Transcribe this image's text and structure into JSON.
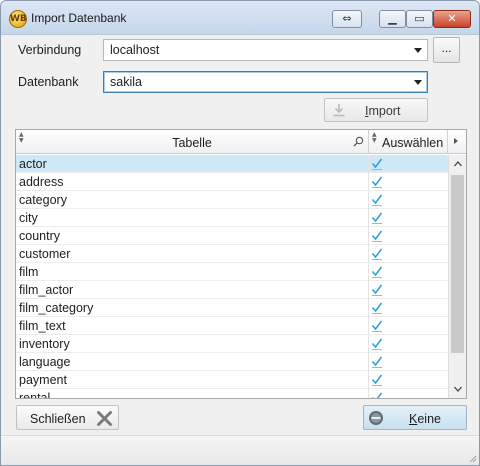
{
  "window": {
    "title": "Import Datenbank",
    "icon_name": "app-logo-icon",
    "icon_text": "WB",
    "controls": [
      "sync-icon",
      "minimize-icon",
      "maximize-icon",
      "close-icon"
    ]
  },
  "form": {
    "connection_label": "Verbindung",
    "connection_value": "localhost",
    "database_label": "Datenbank",
    "database_value": "sakila",
    "browse_label": "...",
    "import_label_prefix": "",
    "import_label_mnemonic": "I",
    "import_label_rest": "mport"
  },
  "grid": {
    "columns": [
      "Tabelle",
      "Auswählen"
    ],
    "rows": [
      {
        "name": "actor",
        "selected": true,
        "checked": true
      },
      {
        "name": "address",
        "selected": false,
        "checked": true
      },
      {
        "name": "category",
        "selected": false,
        "checked": true
      },
      {
        "name": "city",
        "selected": false,
        "checked": true
      },
      {
        "name": "country",
        "selected": false,
        "checked": true
      },
      {
        "name": "customer",
        "selected": false,
        "checked": true
      },
      {
        "name": "film",
        "selected": false,
        "checked": true
      },
      {
        "name": "film_actor",
        "selected": false,
        "checked": true
      },
      {
        "name": "film_category",
        "selected": false,
        "checked": true
      },
      {
        "name": "film_text",
        "selected": false,
        "checked": true
      },
      {
        "name": "inventory",
        "selected": false,
        "checked": true
      },
      {
        "name": "language",
        "selected": false,
        "checked": true
      },
      {
        "name": "payment",
        "selected": false,
        "checked": true
      },
      {
        "name": "rental",
        "selected": false,
        "checked": true
      }
    ]
  },
  "footer": {
    "close_label": "Schließen",
    "none_label_mnemonic": "K",
    "none_label_rest": "eine"
  },
  "colors": {
    "selection": "#cfe8f7",
    "check": "#2a9fd6",
    "focus_border": "#3c7fb1"
  }
}
